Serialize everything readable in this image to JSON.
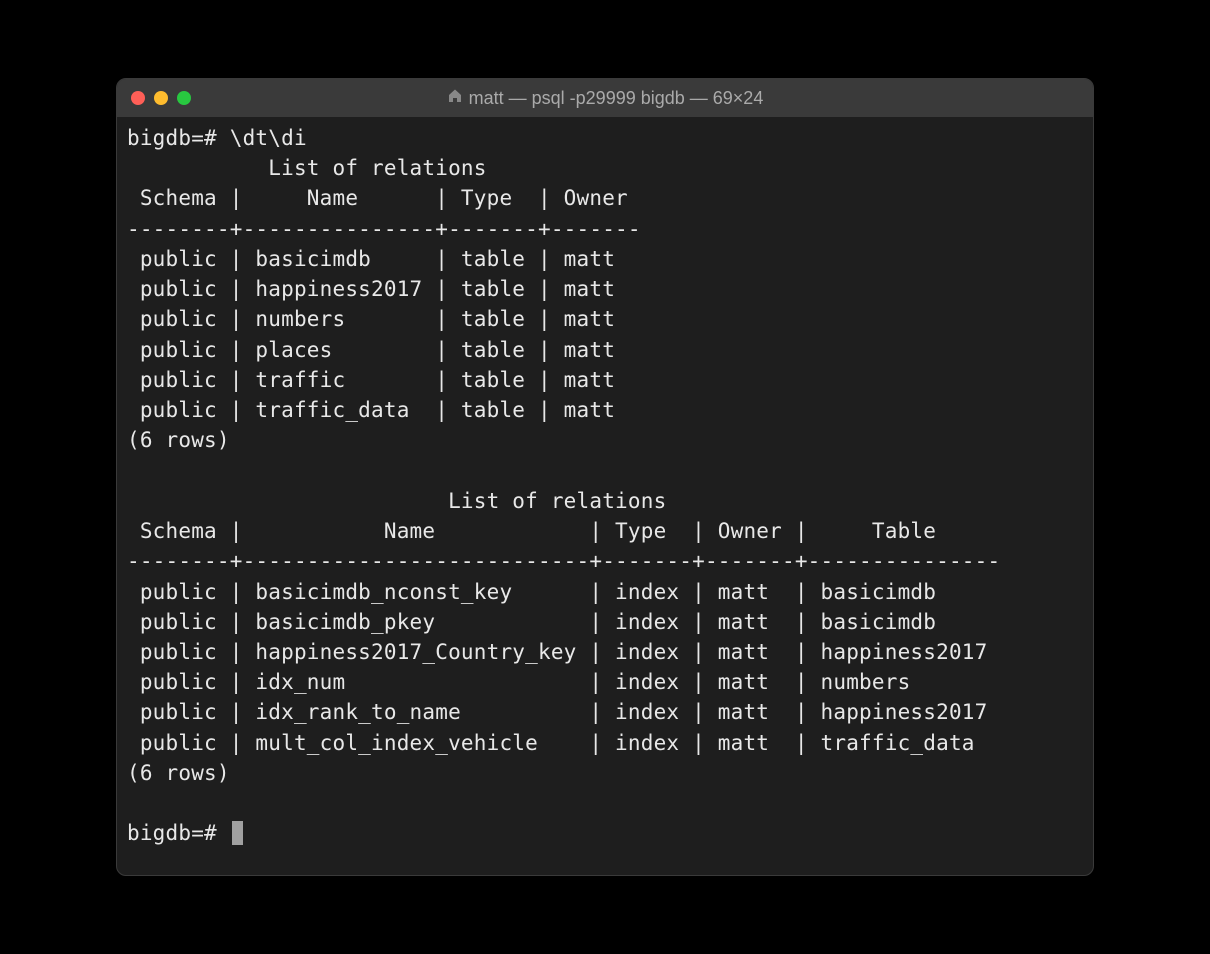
{
  "window": {
    "title": "matt — psql -p29999 bigdb — 69×24"
  },
  "prompt": "bigdb=#",
  "command": "\\dt\\di",
  "section1": {
    "title": "List of relations",
    "headers": {
      "schema": "Schema",
      "name": "Name",
      "type": "Type",
      "owner": "Owner"
    },
    "col_widths": {
      "schema": 8,
      "name": 15,
      "type": 7,
      "owner": 7
    },
    "rows": [
      {
        "schema": "public",
        "name": "basicimdb",
        "type": "table",
        "owner": "matt"
      },
      {
        "schema": "public",
        "name": "happiness2017",
        "type": "table",
        "owner": "matt"
      },
      {
        "schema": "public",
        "name": "numbers",
        "type": "table",
        "owner": "matt"
      },
      {
        "schema": "public",
        "name": "places",
        "type": "table",
        "owner": "matt"
      },
      {
        "schema": "public",
        "name": "traffic",
        "type": "table",
        "owner": "matt"
      },
      {
        "schema": "public",
        "name": "traffic_data",
        "type": "table",
        "owner": "matt"
      }
    ],
    "footer": "(6 rows)"
  },
  "section2": {
    "title": "List of relations",
    "headers": {
      "schema": "Schema",
      "name": "Name",
      "type": "Type",
      "owner": "Owner",
      "table": "Table"
    },
    "col_widths": {
      "schema": 8,
      "name": 27,
      "type": 7,
      "owner": 7,
      "table": 15
    },
    "rows": [
      {
        "schema": "public",
        "name": "basicimdb_nconst_key",
        "type": "index",
        "owner": "matt",
        "table": "basicimdb"
      },
      {
        "schema": "public",
        "name": "basicimdb_pkey",
        "type": "index",
        "owner": "matt",
        "table": "basicimdb"
      },
      {
        "schema": "public",
        "name": "happiness2017_Country_key",
        "type": "index",
        "owner": "matt",
        "table": "happiness2017"
      },
      {
        "schema": "public",
        "name": "idx_num",
        "type": "index",
        "owner": "matt",
        "table": "numbers"
      },
      {
        "schema": "public",
        "name": "idx_rank_to_name",
        "type": "index",
        "owner": "matt",
        "table": "happiness2017"
      },
      {
        "schema": "public",
        "name": "mult_col_index_vehicle",
        "type": "index",
        "owner": "matt",
        "table": "traffic_data"
      }
    ],
    "footer": "(6 rows)"
  }
}
